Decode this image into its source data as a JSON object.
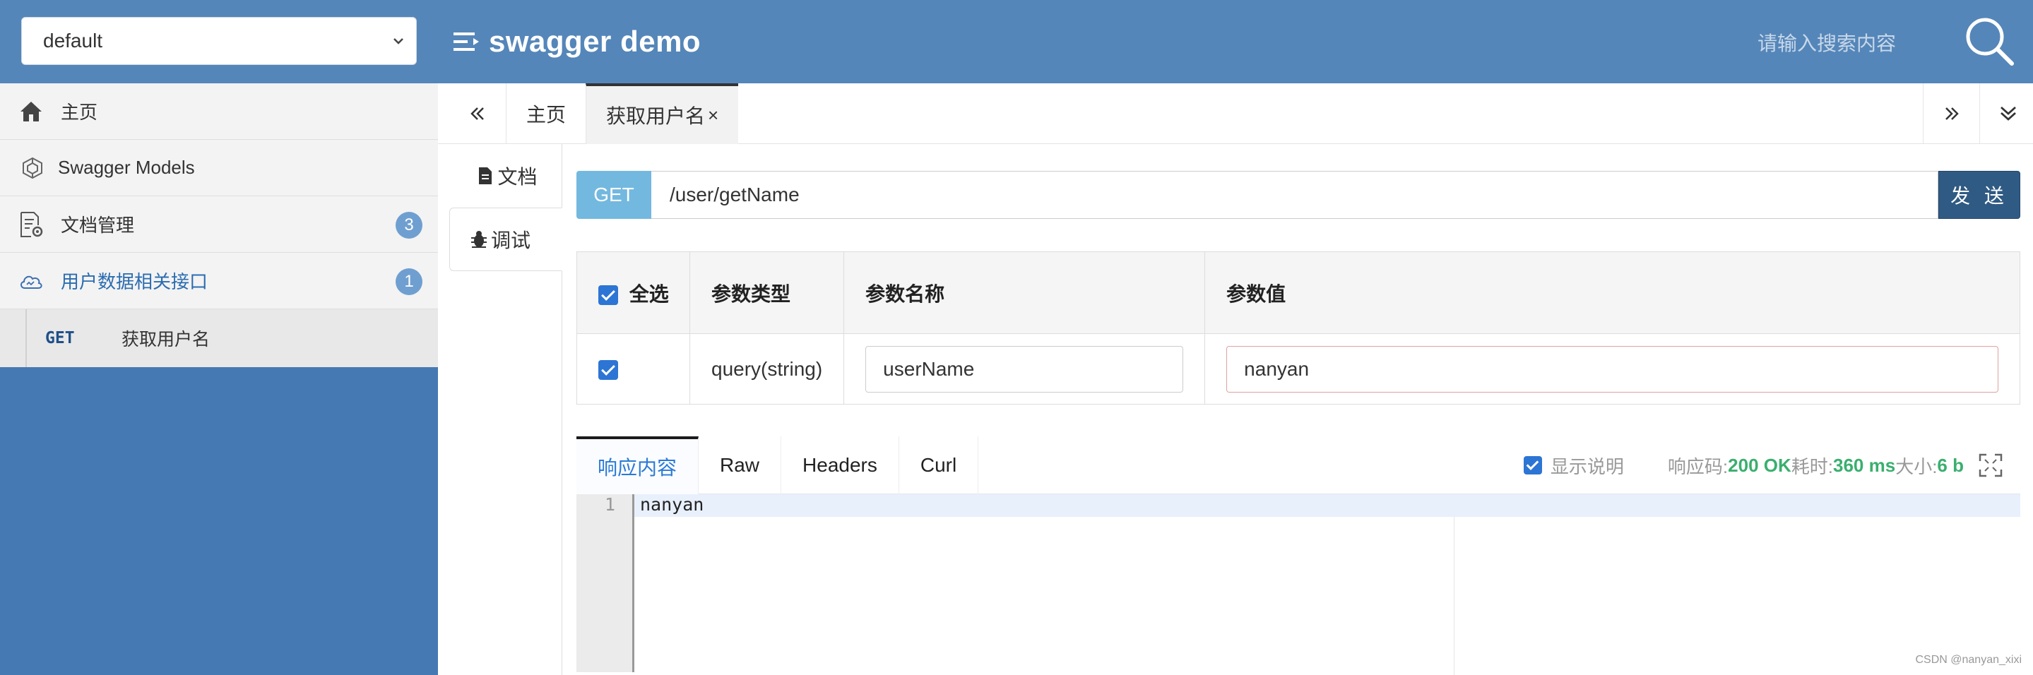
{
  "header": {
    "group_select": "default",
    "title": "swagger demo",
    "search_placeholder": "请输入搜索内容"
  },
  "sidebar": {
    "items": [
      {
        "label": "主页",
        "icon": "home-icon"
      },
      {
        "label": "Swagger Models",
        "icon": "models-icon"
      },
      {
        "label": "文档管理",
        "icon": "doc-settings-icon",
        "badge": "3"
      },
      {
        "label": "用户数据相关接口",
        "icon": "cloud-icon",
        "badge": "1"
      }
    ],
    "sub_item": {
      "method": "GET",
      "label": "获取用户名"
    }
  },
  "tabs": {
    "items": [
      {
        "label": "主页"
      },
      {
        "label": "获取用户名",
        "close": "×"
      }
    ]
  },
  "vtabs": {
    "doc": "文档",
    "debug": "调试"
  },
  "request": {
    "method": "GET",
    "url": "/user/getName",
    "send_label": "发 送"
  },
  "params": {
    "headers": {
      "select_all": "全选",
      "type": "参数类型",
      "name": "参数名称",
      "value": "参数值"
    },
    "rows": [
      {
        "type": "query(string)",
        "name": "userName",
        "value": "nanyan"
      }
    ]
  },
  "response": {
    "tabs": [
      "响应内容",
      "Raw",
      "Headers",
      "Curl"
    ],
    "show_desc": "显示说明",
    "code_label": "响应码:",
    "code_value": "200 OK",
    "time_label": "耗时:",
    "time_value": "360 ms",
    "size_label": "大小:",
    "size_value": "6 b",
    "line_number": "1",
    "body": "nanyan"
  },
  "watermark": "CSDN @nanyan_xixi",
  "colors": {
    "header_bg": "#5586b9",
    "sidebar_bg": "#4579b3",
    "method_get": "#73b8df",
    "send_btn": "#2f5a83",
    "status_green": "#3aaf6e"
  }
}
